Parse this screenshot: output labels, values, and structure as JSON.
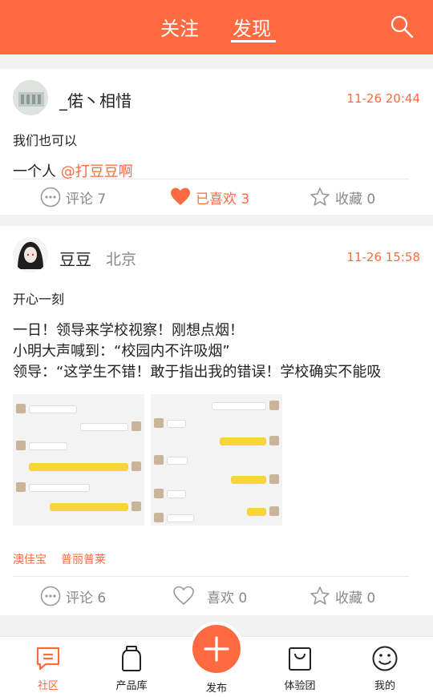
{
  "header": {
    "tab_follow": "关注",
    "tab_discover": "发现",
    "search_icon": "search-icon",
    "bg_color": "#ff6a40"
  },
  "posts": [
    {
      "username": "_偌丶相惜",
      "timestamp": "11-26 20:44",
      "line1": "我们也可以",
      "line2_prefix": "一个人 ",
      "mention": "@打豆豆啊",
      "comment_label": "评论 7",
      "like_label": "已喜欢 3",
      "favorite_label": "收藏 0"
    },
    {
      "username": "豆豆",
      "location": "北京",
      "timestamp": "11-26 15:58",
      "line1": "开心一刻",
      "line2": "一日！领导来学校视察！刚想点烟！",
      "line3": "小明大声喊到：“校园内不许吸烟”",
      "line4": "领导：“这学生不错！敢于指出我的错误！学校确实不能吸",
      "tags": [
        "澳佳宝",
        "普丽普莱"
      ],
      "comment_label": "评论 6",
      "like_label": "喜欢 0",
      "favorite_label": "收藏 0"
    }
  ],
  "bottom_nav": {
    "community": "社区",
    "products": "产品库",
    "publish": "发布",
    "experience": "体验团",
    "mine": "我的"
  },
  "accent_color": "#ff6a40"
}
